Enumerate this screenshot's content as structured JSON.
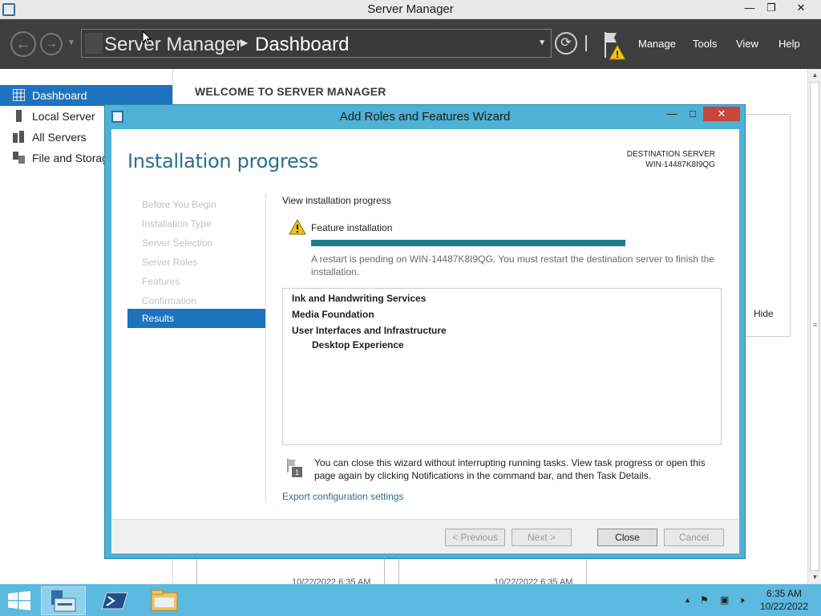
{
  "window": {
    "title": "Server Manager",
    "minimize_label": "—",
    "restore_label": "❐",
    "close_label": "✕"
  },
  "breadcrumb": {
    "root": "Server Manager",
    "current": "Dashboard"
  },
  "commands": {
    "manage": "Manage",
    "tools": "Tools",
    "view": "View",
    "help": "Help"
  },
  "sidebar": {
    "items": [
      {
        "label": "Dashboard",
        "icon": "dashboard-icon",
        "active": true
      },
      {
        "label": "Local Server",
        "icon": "server-icon",
        "active": false
      },
      {
        "label": "All Servers",
        "icon": "servers-icon",
        "active": false
      },
      {
        "label": "File and Storag",
        "icon": "file-storage-icon",
        "active": false
      }
    ]
  },
  "main": {
    "welcome": "WELCOME TO SERVER MANAGER",
    "hide_label": "Hide",
    "tile_timestamps": [
      "10/22/2022 6:35 AM",
      "10/22/2022 6:35 AM"
    ]
  },
  "wizard": {
    "title": "Add Roles and Features Wizard",
    "heading": "Installation progress",
    "destination_label": "DESTINATION SERVER",
    "destination_server": "WIN-14487K8I9QG",
    "steps": [
      {
        "label": "Before You Begin",
        "active": false
      },
      {
        "label": "Installation Type",
        "active": false
      },
      {
        "label": "Server Selection",
        "active": false
      },
      {
        "label": "Server Roles",
        "active": false
      },
      {
        "label": "Features",
        "active": false
      },
      {
        "label": "Confirmation",
        "active": false
      },
      {
        "label": "Results",
        "active": true
      }
    ],
    "view_progress_label": "View installation progress",
    "feature_label": "Feature installation",
    "progress_fraction": 1.0,
    "restart_message": "A restart is pending on WIN-14487K8I9QG. You must restart the destination server to finish the installation.",
    "results": [
      {
        "label": "Ink and Handwriting Services",
        "level": 0
      },
      {
        "label": "Media Foundation",
        "level": 0
      },
      {
        "label": "User Interfaces and Infrastructure",
        "level": 0
      },
      {
        "label": "Desktop Experience",
        "level": 1
      }
    ],
    "notification_text": "You can close this wizard without interrupting running tasks. View task progress or open this page again by clicking Notifications in the command bar, and then Task Details.",
    "notification_badge": "1",
    "export_link": "Export configuration settings",
    "buttons": {
      "previous": "< Previous",
      "next": "Next >",
      "close": "Close",
      "cancel": "Cancel"
    }
  },
  "taskbar": {
    "time": "6:35 AM",
    "date": "10/22/2022",
    "items": [
      "server-manager-icon",
      "powershell-icon",
      "file-explorer-icon"
    ]
  },
  "colors": {
    "accent": "#1e73be",
    "wizard_frame": "#4fb1d4",
    "progress": "#1b7d89",
    "heading": "#2a6e8f",
    "taskbar": "#5cb9df",
    "navbar": "#3e3e3e"
  }
}
